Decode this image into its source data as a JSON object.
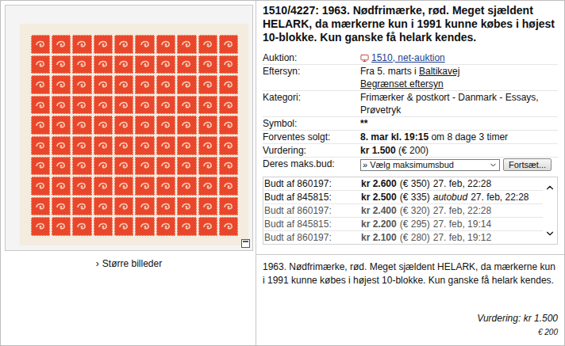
{
  "lot": {
    "title": "1510/4227: 1963. Nødfrimærke, rød. Meget sjældent HELARK, da mærkerne kun i 1991 kunne købes i højest 10-blokke. Kun ganske få helark kendes."
  },
  "image": {
    "link_icon": "›",
    "link": "Større billeder"
  },
  "details": [
    {
      "label": "Auktion:",
      "kind": "icon-link",
      "lines": [
        [
          {
            "text": "1510, net-auktion",
            "style": "link"
          }
        ]
      ]
    },
    {
      "label": "Eftersyn:",
      "kind": "text",
      "lines": [
        [
          {
            "text": "Fra 5. marts i ",
            "style": "plain"
          },
          {
            "text": "Baltikavej",
            "style": "underline"
          }
        ],
        [
          {
            "text": "Begrænset eftersyn",
            "style": "underline"
          }
        ]
      ]
    },
    {
      "label": "Kategori:",
      "kind": "text",
      "lines": [
        [
          {
            "text": "Frimærker & postkort - Danmark - Essays,",
            "style": "plain"
          }
        ],
        [
          {
            "text": "Prøvetryk",
            "style": "plain"
          }
        ]
      ]
    },
    {
      "label": "Symbol:",
      "kind": "text",
      "lines": [
        [
          {
            "text": "**",
            "style": "bold"
          }
        ]
      ]
    },
    {
      "label": "Forventes solgt:",
      "kind": "text",
      "lines": [
        [
          {
            "text": "8. mar kl. 19:15",
            "style": "bold"
          },
          {
            "text": " om 8 dage 3 timer",
            "style": "plain"
          }
        ]
      ]
    },
    {
      "label": "Vurdering:",
      "kind": "text",
      "lines": [
        [
          {
            "text": "kr 1.500",
            "style": "bold"
          },
          {
            "text": " (€ 200)",
            "style": "plain"
          }
        ]
      ]
    },
    {
      "label": "Deres maks.bud:",
      "kind": "select",
      "select": "» Vælg maksimumsbud",
      "button": "Fortsæt..."
    }
  ],
  "bids": [
    {
      "bidder": "Budt af 860197:",
      "amount": "kr 2.600",
      "eur": "(€ 350)",
      "note": "",
      "time": "27. feb, 22:28",
      "faded": false
    },
    {
      "bidder": "Budt af 845815:",
      "amount": "kr 2.500",
      "eur": "(€ 335)",
      "note": "autobud",
      "time": "27. feb, 22:28",
      "faded": false
    },
    {
      "bidder": "Budt af 860197:",
      "amount": "kr 2.400",
      "eur": "(€ 320)",
      "note": "",
      "time": "27. feb, 22:28",
      "faded": true
    },
    {
      "bidder": "Budt af 845815:",
      "amount": "kr 2.200",
      "eur": "(€ 295)",
      "note": "",
      "time": "27. feb, 19:14",
      "faded": true
    },
    {
      "bidder": "Budt af 860197:",
      "amount": "kr 2.100",
      "eur": "(€ 280)",
      "note": "",
      "time": "27. feb, 19:12",
      "faded": true
    }
  ],
  "description": "1963. Nødfrimærke, rød. Meget sjældent HELARK, da mærkerne kun i 1991 kunne købes i højest 10-blokke. Kun ganske få helark kendes.",
  "valuation": {
    "text": "Vurdering: kr 1.500",
    "eur": "€ 200"
  }
}
